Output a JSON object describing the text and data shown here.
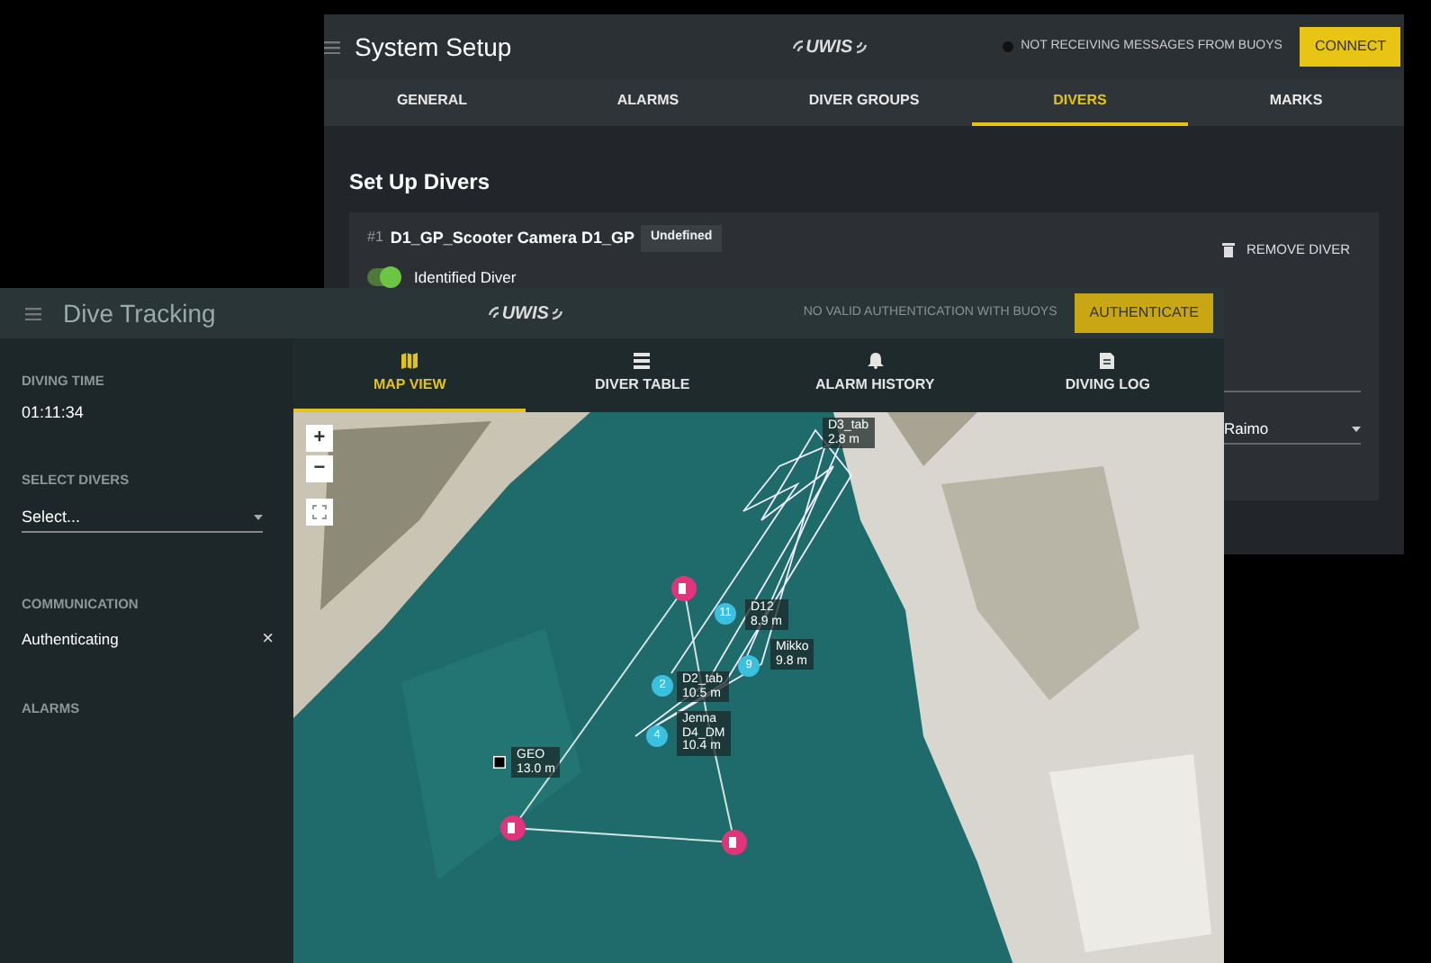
{
  "setup_window": {
    "title": "System Setup",
    "logo": "UWIS",
    "status": "NOT RECEIVING MESSAGES FROM BUOYS",
    "connect_button": "CONNECT",
    "tabs": [
      {
        "label": "GENERAL",
        "selected": false
      },
      {
        "label": "ALARMS",
        "selected": false
      },
      {
        "label": "DIVER GROUPS",
        "selected": false
      },
      {
        "label": "DIVERS",
        "selected": true
      },
      {
        "label": "MARKS",
        "selected": false
      }
    ],
    "heading": "Set Up Divers",
    "diver": {
      "index": "#1",
      "name": "D1_GP_Scooter Camera D1_GP",
      "badge": "Undefined",
      "remove_button": "REMOVE DIVER",
      "toggle_label": "Identified Diver",
      "on": true
    },
    "select_value": "Raimo"
  },
  "tracking_window": {
    "title": "Dive Tracking",
    "logo": "UWIS",
    "status": "NO VALID AUTHENTICATION WITH BUOYS",
    "authenticate_button": "AUTHENTICATE",
    "tabs": [
      {
        "label": "MAP VIEW",
        "kind": "map",
        "selected": true
      },
      {
        "label": "DIVER TABLE",
        "kind": "list",
        "selected": false
      },
      {
        "label": "ALARM HISTORY",
        "kind": "bell",
        "selected": false
      },
      {
        "label": "DIVING LOG",
        "kind": "file",
        "selected": false
      }
    ],
    "sidebar": {
      "diving_time_label": "DIVING TIME",
      "diving_time": "01:11:34",
      "select_divers_label": "SELECT DIVERS",
      "select_placeholder": "Select...",
      "communication_label": "COMMUNICATION",
      "communication_status": "Authenticating",
      "close": "×",
      "alarms_label": "ALARMS"
    },
    "map": {
      "zoom_in": "+",
      "zoom_out": "−",
      "diver_markers": [
        {
          "number": "11"
        },
        {
          "number": "2"
        },
        {
          "number": "4"
        },
        {
          "number": "9"
        }
      ],
      "labels": [
        {
          "lines": [
            "D12",
            "8.9 m"
          ]
        },
        {
          "lines": [
            "Mikko",
            "9.8 m"
          ]
        },
        {
          "lines": [
            "D2_tab",
            "10.5 m"
          ]
        },
        {
          "lines": [
            "Jenna",
            "D4_DM",
            "10.4 m"
          ]
        },
        {
          "lines": [
            "GEO",
            "13.0 m"
          ]
        },
        {
          "lines": [
            "D3_tab",
            "2.8 m"
          ]
        }
      ]
    }
  }
}
